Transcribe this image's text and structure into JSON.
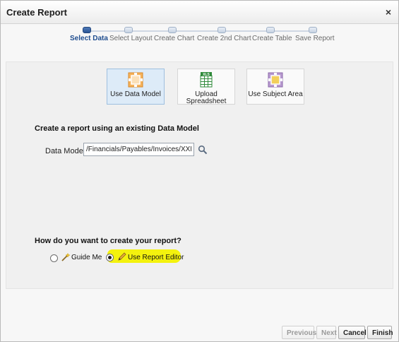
{
  "dialog": {
    "title": "Create Report",
    "close_glyph": "×"
  },
  "train": {
    "steps": [
      {
        "label": "Select Data",
        "active": true
      },
      {
        "label": "Select Layout",
        "active": false
      },
      {
        "label": "Create Chart",
        "active": false
      },
      {
        "label": "Create 2nd Chart",
        "active": false
      },
      {
        "label": "Create Table",
        "active": false
      },
      {
        "label": "Save Report",
        "active": false
      }
    ]
  },
  "sources": {
    "tiles": [
      {
        "label": "Use Data Model",
        "icon": "data-model-icon",
        "selected": true
      },
      {
        "label_line1": "Upload",
        "label_line2": "Spreadsheet",
        "icon": "spreadsheet-icon",
        "icon_badge": "XLS",
        "selected": false
      },
      {
        "label": "Use Subject Area",
        "icon": "subject-area-icon",
        "selected": false
      }
    ]
  },
  "data_model": {
    "heading": "Create a report using an existing Data Model",
    "label": "Data Model",
    "value": "/Financials/Payables/Invoices/XXINVOICE"
  },
  "creation": {
    "question": "How do you want to create your report?",
    "options": [
      {
        "label": "Guide Me",
        "icon": "wand-icon",
        "selected": false
      },
      {
        "label": "Use Report Editor",
        "icon": "pencil-icon",
        "selected": true
      }
    ]
  },
  "footer": {
    "previous": "Previous",
    "next": "Next",
    "cancel": "Cancel",
    "finish": "Finish"
  },
  "colors": {
    "accent": "#2b5595",
    "highlight": "#f4f20e",
    "tile_selected": "#ddebf8"
  }
}
